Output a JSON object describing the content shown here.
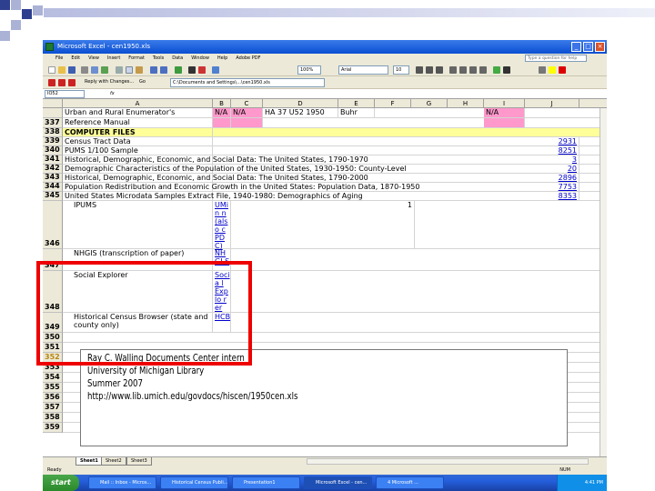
{
  "window": {
    "title": "Microsoft Excel - cen1950.xls",
    "help_placeholder": "Type a question for help"
  },
  "menu": [
    "File",
    "Edit",
    "View",
    "Insert",
    "Format",
    "Tools",
    "Data",
    "Window",
    "Help",
    "Adobe PDF"
  ],
  "toolbar": {
    "zoom": "100%",
    "font": "Arial",
    "font_size": "10",
    "address": "C:\\Documents and Settings\\...\\cen1950.xls",
    "reply_label": "Reply with Changes...",
    "go_label": "Go"
  },
  "formula_bar": {
    "name_box": "IO52",
    "fx": "fx"
  },
  "columns": [
    "A",
    "B",
    "C",
    "D",
    "E",
    "F",
    "G",
    "H",
    "I",
    "J"
  ],
  "rows": [
    {
      "num": "",
      "a": "Urban and Rural Enumerator's",
      "b": "N/A",
      "c": "N/A",
      "d": "HA 37 U52 1950",
      "e": "Buhr",
      "i": "N/A"
    },
    {
      "num": "337",
      "a": "Reference Manual"
    },
    {
      "num": "338",
      "a": "COMPUTER FILES"
    },
    {
      "num": "339",
      "a": "Census Tract Data",
      "j": "2931"
    },
    {
      "num": "340",
      "a": "PUMS 1/100 Sample",
      "j": "8251"
    },
    {
      "num": "341",
      "a": "Historical, Demographic, Economic, and Social Data: The United States, 1790-1970",
      "j": "3"
    },
    {
      "num": "342",
      "a": "Demographic Characteristics of the Population of the United States, 1930-1950: County-Level",
      "j": "20"
    },
    {
      "num": "343",
      "a": "Historical, Demographic, Economic, and Social Data: The United States, 1790-2000",
      "j": "2896"
    },
    {
      "num": "344",
      "a": "Population Redistribution and Economic Growth in the United States: Population Data, 1870-1950",
      "j": "7753"
    },
    {
      "num": "345",
      "a": "United States Microdata Samples Extract File, 1940-1980: Demographics of Aging",
      "j": "8353"
    },
    {
      "num": "346",
      "a": "IPUMS",
      "b": "UMin n (also c PDC)",
      "e_num": "1"
    },
    {
      "num": "347",
      "a": "NHGIS (transcription of paper)",
      "b": "NHGI S"
    },
    {
      "num": "348",
      "a": "Social Explorer",
      "b": "Socia l Explo rer"
    },
    {
      "num": "349",
      "a": "Historical Census Browser (state and county only)",
      "b": "HCB"
    },
    {
      "num": "350"
    },
    {
      "num": "351"
    },
    {
      "num": "352"
    },
    {
      "num": "353"
    },
    {
      "num": "354"
    },
    {
      "num": "355"
    },
    {
      "num": "356"
    },
    {
      "num": "357"
    },
    {
      "num": "358"
    },
    {
      "num": "359"
    }
  ],
  "overlay": {
    "line1": "Ray C. Walling Documents Center intern",
    "line2": "University of Michigan Library",
    "line3": "Summer 2007",
    "line4": "http://www.lib.umich.edu/govdocs/hiscen/1950cen.xls"
  },
  "sheets": [
    "Sheet1",
    "Sheet2",
    "Sheet3"
  ],
  "status": {
    "left": "Ready",
    "right": "NUM"
  },
  "taskbar": {
    "start": "start",
    "items": [
      "Mail :: Inbox - Micros...",
      "Historical Census Publi...",
      "Presentation1",
      "Microsoft Excel - cen...",
      "4 Microsoft ..."
    ],
    "clock": "4:41 PM"
  },
  "colors": {
    "pink": "#ff99cc",
    "yellow": "#ffff99",
    "highlight": "#ee0000",
    "slide_square": "#2f3f8f"
  }
}
